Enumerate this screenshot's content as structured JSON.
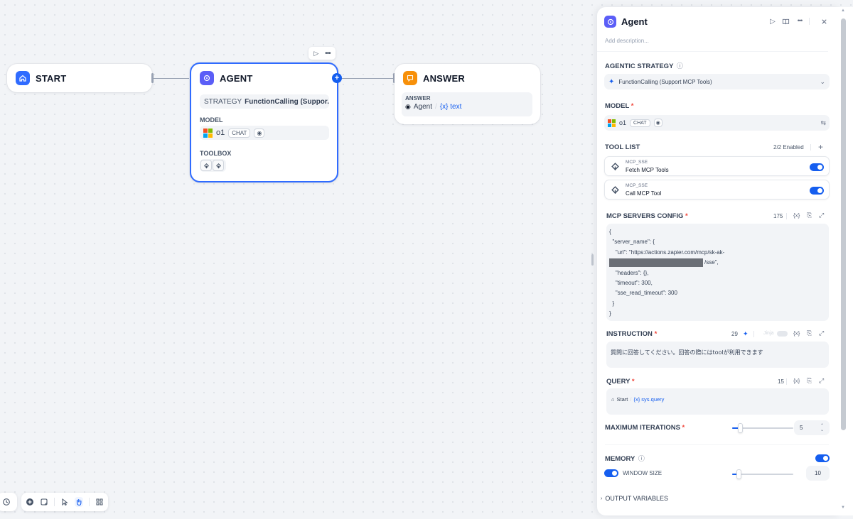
{
  "canvas": {
    "start_node": {
      "title": "START"
    },
    "agent_node": {
      "title": "AGENT",
      "strategy_label": "STRATEGY",
      "strategy_value": "FunctionCalling (Suppor...",
      "model_label": "MODEL",
      "model_name": "o1",
      "model_tag": "CHAT",
      "toolbox_label": "TOOLBOX"
    },
    "answer_node": {
      "title": "ANSWER",
      "field_label": "ANSWER",
      "source_node": "Agent",
      "variable": "{x} text"
    }
  },
  "panel": {
    "title": "Agent",
    "description_placeholder": "Add description...",
    "agentic_strategy": {
      "label": "AGENTIC STRATEGY",
      "value": "FunctionCalling (Support MCP Tools)"
    },
    "model": {
      "label": "MODEL",
      "name": "o1",
      "tag": "CHAT"
    },
    "tool_list": {
      "label": "TOOL LIST",
      "enabled_count": "2/2 Enabled",
      "items": [
        {
          "provider": "MCP_SSE",
          "name": "Fetch MCP Tools",
          "enabled": true
        },
        {
          "provider": "MCP_SSE",
          "name": "Call MCP Tool",
          "enabled": true
        }
      ]
    },
    "mcp_config": {
      "label": "MCP SERVERS CONFIG",
      "char_count": "175",
      "lines": [
        "{",
        "  \"server_name\": {",
        "    \"url\": \"https://actions.zapier.com/mcp/sk-ak-",
        "/sse\",",
        "    \"headers\": {},",
        "    \"timeout\": 300,",
        "    \"sse_read_timeout\": 300",
        "  }",
        "}"
      ]
    },
    "instruction": {
      "label": "INSTRUCTION",
      "char_count": "29",
      "jinja_label": "Jinja",
      "text": "質問に回答してください。回答の際にはtoolが利用できます"
    },
    "query": {
      "label": "QUERY",
      "char_count": "15",
      "source_node": "Start",
      "variable": "{x} sys.query"
    },
    "max_iterations": {
      "label": "MAXIMUM ITERATIONS",
      "value": "5",
      "fraction": 0.1
    },
    "memory": {
      "label": "MEMORY",
      "enabled": true,
      "window_size_label": "WINDOW SIZE",
      "window_size_enabled": true,
      "window_size_value": "10",
      "fraction": 0.1
    },
    "output_variables": {
      "label": "OUTPUT VARIABLES"
    }
  },
  "colors": {
    "accent": "#155eef",
    "start_icon": "#2f6bff",
    "agent_icon": "#5b5ef7",
    "answer_icon": "#f79009",
    "required": "#f04438"
  }
}
